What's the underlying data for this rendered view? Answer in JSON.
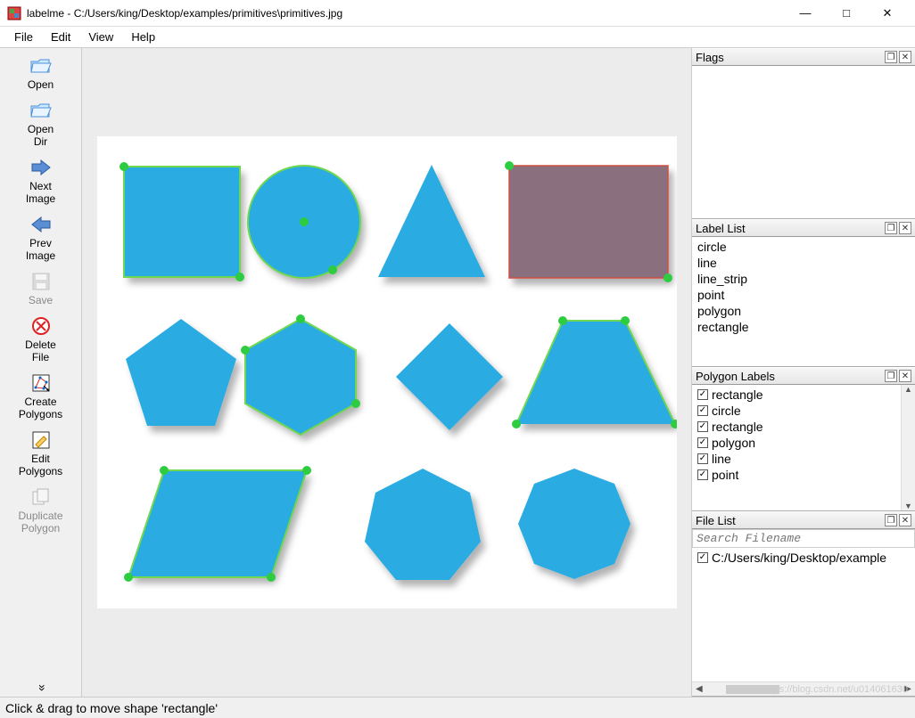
{
  "window": {
    "title": "labelme - C:/Users/king/Desktop/examples/primitives\\primitives.jpg",
    "controls": {
      "min": "—",
      "max": "□",
      "close": "✕"
    }
  },
  "menu": {
    "file": "File",
    "edit": "Edit",
    "view": "View",
    "help": "Help"
  },
  "toolbar": {
    "open": "Open",
    "open_dir": "Open\nDir",
    "next": "Next\nImage",
    "prev": "Prev\nImage",
    "save": "Save",
    "delete": "Delete\nFile",
    "create": "Create\nPolygons",
    "edit_poly": "Edit\nPolygons",
    "duplicate": "Duplicate\nPolygon",
    "expand": "»"
  },
  "panels": {
    "flags": {
      "title": "Flags"
    },
    "label_list": {
      "title": "Label List",
      "items": [
        "circle",
        "line",
        "line_strip",
        "point",
        "polygon",
        "rectangle"
      ]
    },
    "polygon_labels": {
      "title": "Polygon Labels",
      "items": [
        "rectangle",
        "circle",
        "rectangle",
        "polygon",
        "line",
        "point"
      ]
    },
    "file_list": {
      "title": "File List",
      "search_placeholder": "Search Filename",
      "items": [
        "C:/Users/king/Desktop/example"
      ]
    }
  },
  "status": {
    "text": "Click & drag to move shape 'rectangle'"
  },
  "watermark": "https://blog.csdn.net/u014061630",
  "colors": {
    "shape_fill": "#29abe2",
    "rect_sel_fill": "#8a6f7f",
    "rect_sel_stroke": "#d05040",
    "vertex": "#2ecc40",
    "outline": "#6fd84e"
  }
}
